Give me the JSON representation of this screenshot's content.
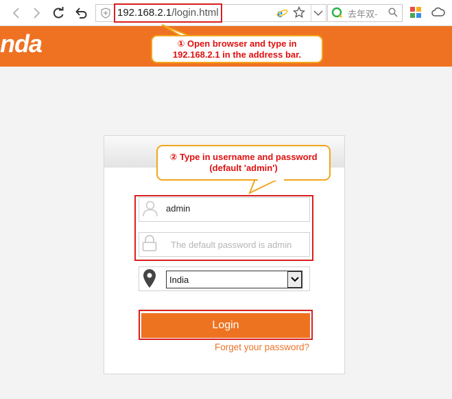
{
  "browser": {
    "url_host": "192.168.2.1",
    "url_path": "/login.html",
    "search_text": "去年双-"
  },
  "banner": {
    "logo_text": "nda"
  },
  "callouts": {
    "step1_line1": "① Open browser and type in",
    "step1_line2": "192.168.2.1 in the address bar.",
    "step2_line1": "② Type in username and password",
    "step2_line2": "(default 'admin')"
  },
  "login": {
    "username_value": "admin",
    "password_placeholder": "The default password is admin",
    "language_value": "India",
    "login_label": "Login",
    "forget_label": "Forget your password?"
  },
  "colors": {
    "accent": "#ef7223",
    "highlight": "#d81e1e",
    "callout_border": "#f2a51a"
  }
}
